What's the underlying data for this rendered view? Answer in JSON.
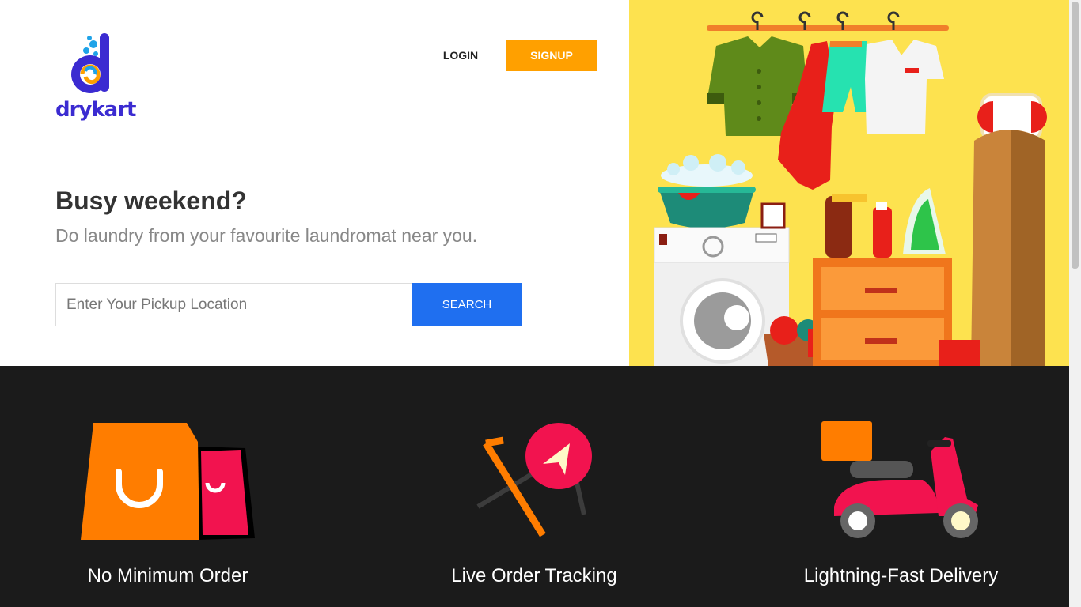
{
  "brand": {
    "name": "drykart",
    "colors": {
      "primary": "#3b2bd1",
      "accent": "#ffa000",
      "search": "#1f6ff0"
    }
  },
  "header": {
    "login_label": "LOGIN",
    "signup_label": "SIGNUP"
  },
  "hero": {
    "headline": "Busy weekend?",
    "subline": "Do laundry from your favourite laundromat near you.",
    "search": {
      "placeholder": "Enter Your Pickup Location",
      "value": "",
      "button_label": "SEARCH"
    },
    "illustration": "laundry-room-illustration"
  },
  "features": [
    {
      "title": "No Minimum Order",
      "icon": "shopping-bag-icon"
    },
    {
      "title": "Live Order Tracking",
      "icon": "location-tracking-icon"
    },
    {
      "title": "Lightning-Fast Delivery",
      "icon": "delivery-scooter-icon"
    }
  ]
}
